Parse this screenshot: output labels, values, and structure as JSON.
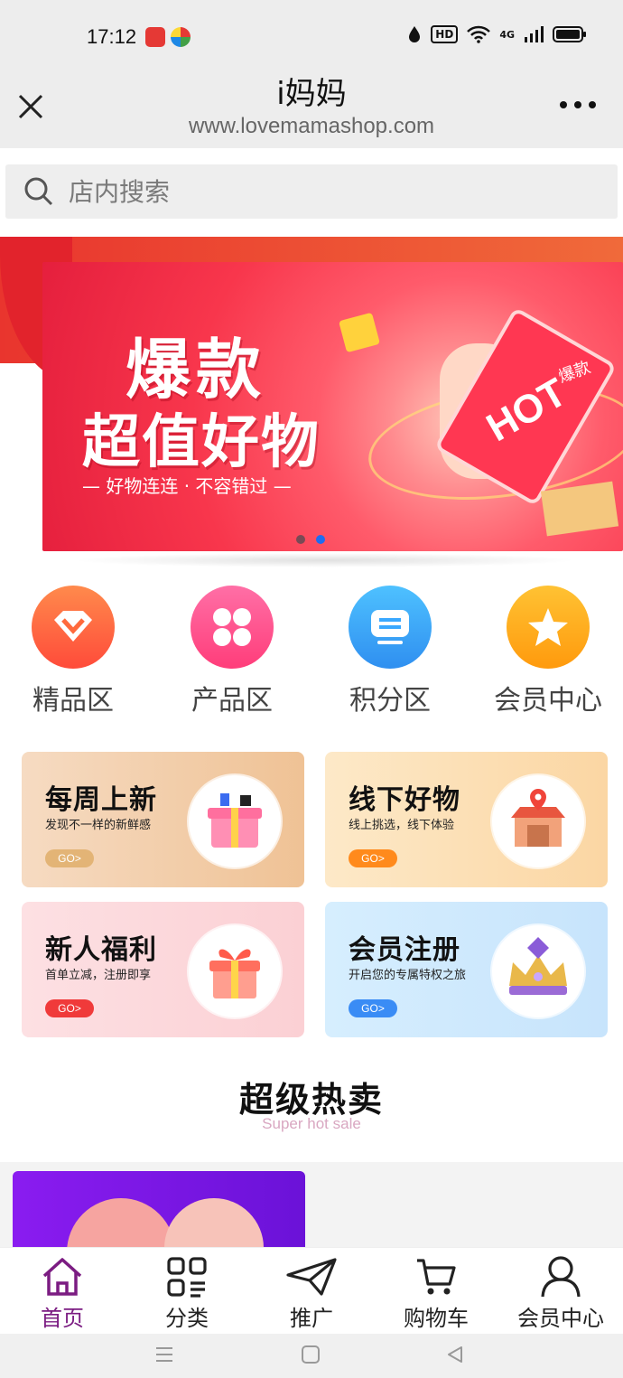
{
  "status_bar": {
    "time": "17:12",
    "hd_label": "HD",
    "network_label": "4G",
    "app_badge_colors": [
      "#e53935",
      "#43a047"
    ]
  },
  "titlebar": {
    "title": "i妈妈",
    "subtitle": "www.lovemamashop.com",
    "close_icon": "close-icon",
    "more_icon": "more-icon"
  },
  "search": {
    "placeholder": "店内搜索"
  },
  "banner": {
    "title_line1": "爆款",
    "title_line2": "超值好物",
    "tagline": "— 好物连连 · 不容错过 —",
    "ticket_text": "HOT",
    "ticket_tag": "爆款",
    "active_slide": 2,
    "slide_count": 2
  },
  "categories": [
    {
      "label": "精品区",
      "icon": "diamond-icon",
      "color": "#ff6a3d"
    },
    {
      "label": "产品区",
      "icon": "grid-icon",
      "color": "#ff4f8a"
    },
    {
      "label": "积分区",
      "icon": "message-icon",
      "color": "#3aa8ff"
    },
    {
      "label": "会员中心",
      "icon": "star-icon",
      "color": "#ffb31a"
    }
  ],
  "cards": [
    {
      "title": "每周上新",
      "subtitle": "发现不一样的新鲜感",
      "go": "GO>",
      "go_color": "#e3b476",
      "bg": "linear-gradient(90deg,#f6dbc2,#efc295)"
    },
    {
      "title": "线下好物",
      "subtitle": "线上挑选，线下体验",
      "go": "GO>",
      "go_color": "#ff8a1c",
      "bg": "linear-gradient(90deg,#fde9c8,#fbd6a3)"
    },
    {
      "title": "新人福利",
      "subtitle": "首单立减，注册即享",
      "go": "GO>",
      "go_color": "#f03a3a",
      "bg": "linear-gradient(90deg,#fde0e3,#fbd0d4)"
    },
    {
      "title": "会员注册",
      "subtitle": "开启您的专属特权之旅",
      "go": "GO>",
      "go_color": "#3a8cf5",
      "bg": "linear-gradient(90deg,#d6eefe,#c7e4fc)"
    }
  ],
  "hot_sale": {
    "title": "超级热卖",
    "subtitle": "Super hot sale"
  },
  "bottom_nav": [
    {
      "label": "首页",
      "icon": "home-icon",
      "active": true
    },
    {
      "label": "分类",
      "icon": "category-icon",
      "active": false
    },
    {
      "label": "推广",
      "icon": "paper-plane-icon",
      "active": false
    },
    {
      "label": "购物车",
      "icon": "cart-icon",
      "active": false
    },
    {
      "label": "会员中心",
      "icon": "user-icon",
      "active": false
    }
  ],
  "system_nav": [
    "menu-icon",
    "home-square-icon",
    "back-icon"
  ]
}
